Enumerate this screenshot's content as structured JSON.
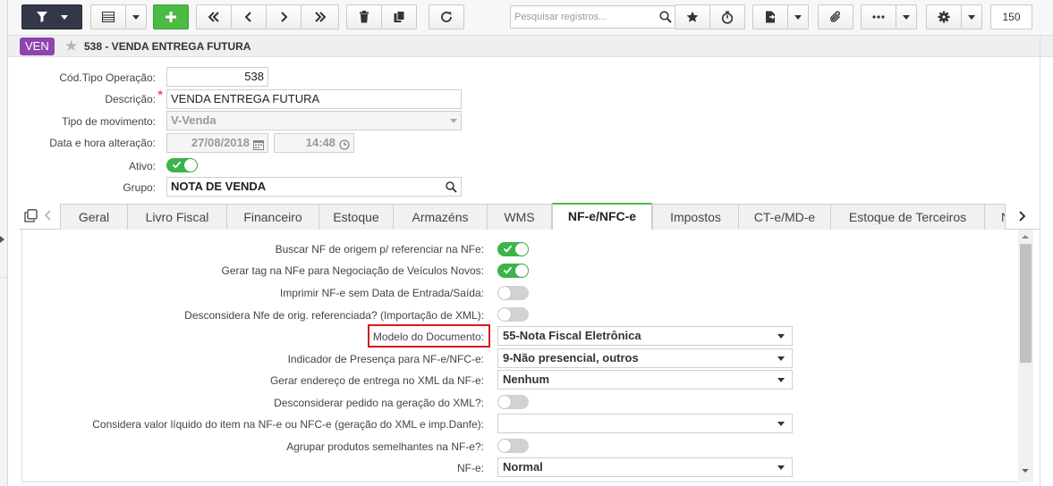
{
  "toolbar": {
    "search_placeholder": "Pesquisar registros...",
    "page_size": "150",
    "icons": [
      "filter-icon",
      "grid-icon",
      "add-icon",
      "first-icon",
      "prev-icon",
      "next-icon",
      "last-icon",
      "trash-icon",
      "copy-icon",
      "refresh-icon",
      "search-icon",
      "star-icon",
      "stopwatch-icon",
      "export-icon",
      "paperclip-icon",
      "more-icon",
      "gear-icon"
    ]
  },
  "header": {
    "badge": "VEN",
    "title": "538 - VENDA ENTREGA FUTURA"
  },
  "form": {
    "tipo_operacao_label": "Cód.Tipo Operação:",
    "tipo_operacao_value": "538",
    "descricao_label": "Descrição:",
    "descricao_value": "VENDA ENTREGA FUTURA",
    "tipo_movimento_label": "Tipo de movimento:",
    "tipo_movimento_value": "V-Venda",
    "data_hora_label": "Data e hora alteração:",
    "data_value": "27/08/2018",
    "hora_value": "14:48",
    "ativo_label": "Ativo:",
    "ativo_value": true,
    "grupo_label": "Grupo:",
    "grupo_value": "NOTA DE VENDA"
  },
  "tabs": [
    {
      "label": "Geral"
    },
    {
      "label": "Livro Fiscal"
    },
    {
      "label": "Financeiro"
    },
    {
      "label": "Estoque"
    },
    {
      "label": "Armazéns"
    },
    {
      "label": "WMS"
    },
    {
      "label": "NF-e/NFC-e",
      "active": true
    },
    {
      "label": "Impostos"
    },
    {
      "label": "CT-e/MD-e"
    },
    {
      "label": "Estoque de Terceiros"
    },
    {
      "label": "N"
    }
  ],
  "nfe_panel": {
    "buscar_nf_label": "Buscar NF de origem p/ referenciar na NFe:",
    "buscar_nf_value": true,
    "gerar_tag_label": "Gerar tag na NFe para Negociação de Veículos Novos:",
    "gerar_tag_value": true,
    "imprimir_label": "Imprimir NF-e sem Data de Entrada/Saída:",
    "imprimir_value": false,
    "desconsidera_nfe_label": "Desconsidera Nfe de orig. referenciada? (Importação de XML):",
    "desconsidera_nfe_value": false,
    "modelo_label": "Modelo do Documento:",
    "modelo_value": "55-Nota Fiscal Eletrônica",
    "indicador_label": "Indicador de Presença para NF-e/NFC-e:",
    "indicador_value": "9-Não presencial, outros",
    "gerar_endereco_label": "Gerar endereço de entrega no XML da NF-e:",
    "gerar_endereco_value": "Nenhum",
    "desconsiderar_pedido_label": "Desconsiderar pedido na geração do XML?:",
    "desconsiderar_pedido_value": false,
    "considera_valor_label": "Considera valor líquido do item na NF-e ou NFC-e (geração do XML e imp.Danfe):",
    "considera_valor_value": "",
    "agrupar_label": "Agrupar produtos semelhantes na NF-e?:",
    "agrupar_value": false,
    "nfe_label": "NF-e:",
    "nfe_value": "Normal"
  },
  "colors": {
    "accent_green": "#4cba43",
    "toggle_on": "#3bb54a",
    "badge_purple": "#8e44ad",
    "dark_button": "#33374a",
    "highlight_red": "#d71920"
  }
}
